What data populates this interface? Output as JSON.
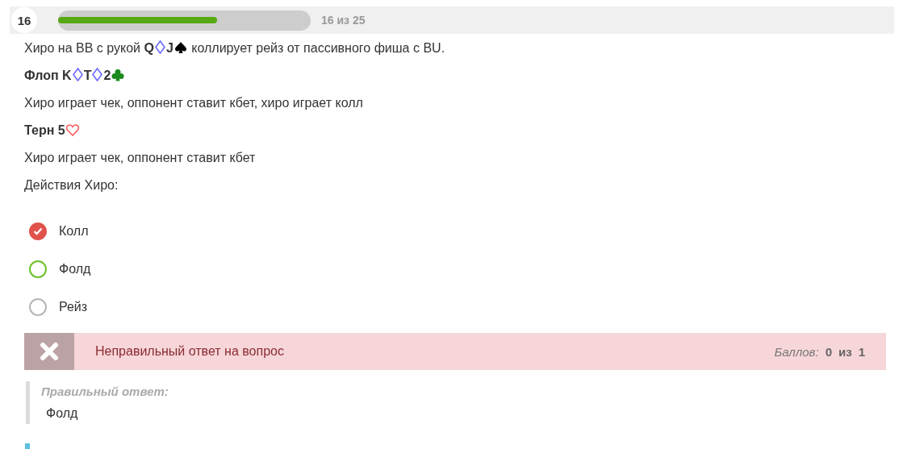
{
  "header": {
    "number": "16",
    "progress": {
      "level": 0.63
    },
    "counter": "16 из 25"
  },
  "paragraphs": [
    {
      "kind": "text",
      "parts": [
        {
          "kind": "text",
          "text": "Хиро на BB с рукой **Q**"
        },
        {
          "kind": "diamond",
          "color": "#6a6aff"
        },
        {
          "kind": "text",
          "text": "**J**"
        },
        {
          "kind": "spade",
          "color": "#000000"
        },
        {
          "kind": "text",
          "text": " коллирует рейз от пассивного фиша с BU."
        }
      ]
    },
    {
      "kind": "heading",
      "parts": [
        {
          "kind": "text",
          "text": "Флоп K"
        },
        {
          "kind": "diamond",
          "color": "#6a6aff"
        },
        {
          "kind": "text",
          "text": "T"
        },
        {
          "kind": "diamond",
          "color": "#6a6aff"
        },
        {
          "kind": "text",
          "text": "2"
        },
        {
          "kind": "club",
          "color": "#1a8a1a"
        }
      ]
    },
    {
      "kind": "text",
      "parts": [
        {
          "kind": "text",
          "text": "Хиро играет чек, оппонент ставит кбет, хиро играет колл"
        }
      ]
    },
    {
      "kind": "heading",
      "parts": [
        {
          "kind": "text",
          "text": "Терн 5"
        },
        {
          "kind": "heart",
          "color": "#ff5a5a"
        }
      ]
    },
    {
      "kind": "text",
      "parts": [
        {
          "kind": "text",
          "text": "Хиро играет чек, оппонент ставит кбет"
        }
      ]
    },
    {
      "kind": "text",
      "parts": [
        {
          "kind": "text",
          "text": "Действия Хиро:"
        }
      ]
    }
  ],
  "options": [
    {
      "label": "Колл",
      "selected": true,
      "correct": false
    },
    {
      "label": "Фолд",
      "selected": false,
      "correct": true
    },
    {
      "label": "Рейз",
      "selected": false,
      "correct": false
    }
  ],
  "feedback": {
    "message": "Неправильный ответ на вопрос",
    "score_label": "Баллов:",
    "score": "0",
    "of": "из",
    "max": "1"
  },
  "correct_answer": {
    "label": "Правильный ответ:",
    "answer": "Фолд"
  }
}
